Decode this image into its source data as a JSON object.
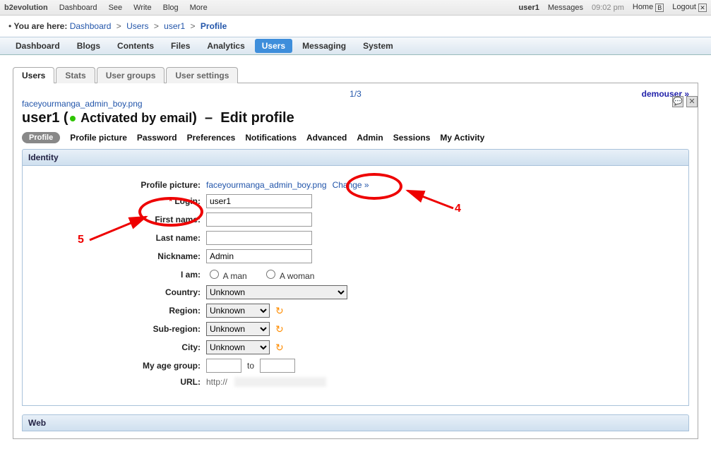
{
  "evobar": {
    "brand": "b2evolution",
    "left_items": [
      "Dashboard",
      "See",
      "Write",
      "Blog",
      "More"
    ],
    "user": "user1",
    "messages": "Messages",
    "time": "09:02 pm",
    "home": "Home",
    "logout": "Logout"
  },
  "breadcrumb": {
    "label": "You are here:",
    "parts": [
      "Dashboard",
      "Users",
      "user1",
      "Profile"
    ]
  },
  "mainnav": {
    "items": [
      "Dashboard",
      "Blogs",
      "Contents",
      "Files",
      "Analytics",
      "Users",
      "Messaging",
      "System"
    ],
    "activeIndex": 5
  },
  "subtabs": {
    "items": [
      "Users",
      "Stats",
      "User groups",
      "User settings"
    ],
    "activeIndex": 0
  },
  "pager": {
    "text": "1/3",
    "next_user": "demouser »"
  },
  "file_link": "faceyourmanga_admin_boy.png",
  "title": {
    "user": "user1",
    "status": "Activated by email",
    "sep": "–",
    "action": "Edit profile"
  },
  "profilenav": {
    "active": "Profile",
    "items": [
      "Profile picture",
      "Password",
      "Preferences",
      "Notifications",
      "Advanced",
      "Admin",
      "Sessions",
      "My Activity"
    ]
  },
  "sections": {
    "identity": "Identity",
    "web": "Web"
  },
  "form": {
    "profile_picture": {
      "label": "Profile picture:",
      "value": "faceyourmanga_admin_boy.png",
      "change": "Change »"
    },
    "login": {
      "label": "Login:",
      "value": "user1"
    },
    "first_name": {
      "label": "First name:",
      "value": ""
    },
    "last_name": {
      "label": "Last name:",
      "value": ""
    },
    "nickname": {
      "label": "Nickname:",
      "value": "Admin"
    },
    "iam": {
      "label": "I am:",
      "opt_man": "A man",
      "opt_woman": "A woman"
    },
    "country": {
      "label": "Country:",
      "value": "Unknown"
    },
    "region": {
      "label": "Region:",
      "value": "Unknown"
    },
    "subregion": {
      "label": "Sub-region:",
      "value": "Unknown"
    },
    "city": {
      "label": "City:",
      "value": "Unknown"
    },
    "age": {
      "label": "My age group:",
      "from": "",
      "to_word": "to",
      "to": ""
    },
    "url": {
      "label": "URL:",
      "proto": "http://"
    }
  },
  "annotations": {
    "n4": "4",
    "n5": "5"
  }
}
